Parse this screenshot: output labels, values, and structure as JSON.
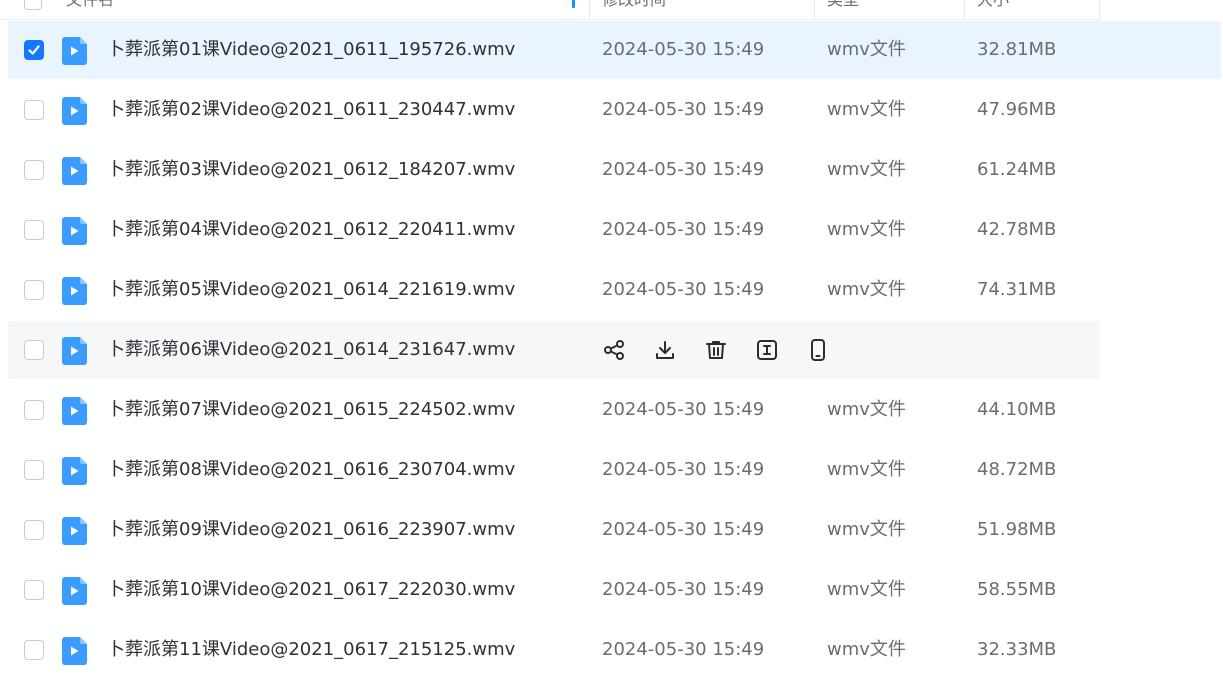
{
  "header": {
    "name_label": "文件名",
    "time_label": "修改时间",
    "type_label": "类型",
    "size_label": "大小"
  },
  "rows": [
    {
      "name": "卜葬派第01课Video@2021_0611_195726.wmv",
      "time": "2024-05-30 15:49",
      "type": "wmv文件",
      "size": "32.81MB",
      "state": "selected"
    },
    {
      "name": "卜葬派第02课Video@2021_0611_230447.wmv",
      "time": "2024-05-30 15:49",
      "type": "wmv文件",
      "size": "47.96MB",
      "state": "normal"
    },
    {
      "name": "卜葬派第03课Video@2021_0612_184207.wmv",
      "time": "2024-05-30 15:49",
      "type": "wmv文件",
      "size": "61.24MB",
      "state": "normal"
    },
    {
      "name": "卜葬派第04课Video@2021_0612_220411.wmv",
      "time": "2024-05-30 15:49",
      "type": "wmv文件",
      "size": "42.78MB",
      "state": "normal"
    },
    {
      "name": "卜葬派第05课Video@2021_0614_221619.wmv",
      "time": "2024-05-30 15:49",
      "type": "wmv文件",
      "size": "74.31MB",
      "state": "normal"
    },
    {
      "name": "卜葬派第06课Video@2021_0614_231647.wmv",
      "time": "",
      "type": "",
      "size": "",
      "state": "hovered"
    },
    {
      "name": "卜葬派第07课Video@2021_0615_224502.wmv",
      "time": "2024-05-30 15:49",
      "type": "wmv文件",
      "size": "44.10MB",
      "state": "normal"
    },
    {
      "name": "卜葬派第08课Video@2021_0616_230704.wmv",
      "time": "2024-05-30 15:49",
      "type": "wmv文件",
      "size": "48.72MB",
      "state": "normal"
    },
    {
      "name": "卜葬派第09课Video@2021_0616_223907.wmv",
      "time": "2024-05-30 15:49",
      "type": "wmv文件",
      "size": "51.98MB",
      "state": "normal"
    },
    {
      "name": "卜葬派第10课Video@2021_0617_222030.wmv",
      "time": "2024-05-30 15:49",
      "type": "wmv文件",
      "size": "58.55MB",
      "state": "normal"
    },
    {
      "name": "卜葬派第11课Video@2021_0617_215125.wmv",
      "time": "2024-05-30 15:49",
      "type": "wmv文件",
      "size": "32.33MB",
      "state": "normal"
    }
  ],
  "hover_actions": [
    "share-icon",
    "download-icon",
    "delete-icon",
    "rename-icon",
    "send-to-phone-icon"
  ],
  "colors": {
    "accent": "#1677ff",
    "selected_row": "#e9f4ff",
    "hover_row": "#f6f7f9",
    "file_icon": "#3b9cff"
  }
}
